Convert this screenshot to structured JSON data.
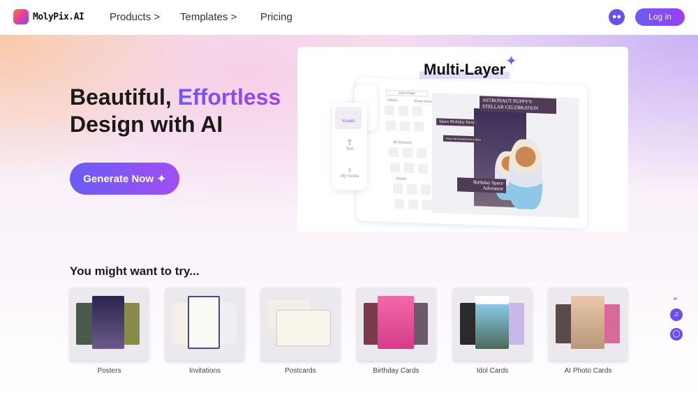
{
  "header": {
    "brand": "MolyPix.AI",
    "nav": [
      {
        "label": "Products",
        "chevron": ">"
      },
      {
        "label": "Templates",
        "chevron": ">"
      },
      {
        "label": "Pricing"
      }
    ],
    "discord_icon": "discord-icon",
    "login_label": "Log in"
  },
  "hero": {
    "title_part1": "Beautiful, ",
    "title_accent": "Effortless",
    "title_line2": "Design with AI",
    "cta_label": "Generate Now",
    "cta_icon": "sparkle-icon",
    "accent_color": "#6a5cf6"
  },
  "showcase": {
    "title": "Multi-Layer",
    "tools": [
      "Visuals",
      "Text",
      "My media"
    ],
    "add_image": "Add image",
    "sections": [
      "Sticker",
      "3D Element",
      "Sketch"
    ],
    "show_more": "Show more >",
    "poster_title": "ASTRONAUT PUPPY'S STELLAR CELEBRATION",
    "poster_sub": "Space Birthday Party",
    "poster_tag": "Enjoy the beautiful starry skies",
    "poster_bottom": "Birthday Space Adventure"
  },
  "try": {
    "heading": "You might want to try...",
    "cards": [
      {
        "label": "Posters"
      },
      {
        "label": "Invitations"
      },
      {
        "label": "Postcards"
      },
      {
        "label": "Birthday Cards"
      },
      {
        "label": "Idol Cards"
      },
      {
        "label": "AI Photo Cards"
      }
    ]
  },
  "side": {
    "icons": [
      "chevron-up-icon",
      "tiktok-icon",
      "instagram-icon"
    ]
  }
}
